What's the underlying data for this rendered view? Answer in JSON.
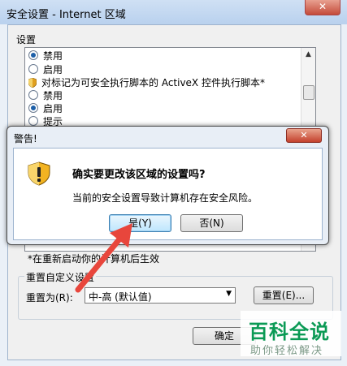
{
  "window": {
    "title": "安全设置 - Internet 区域",
    "settings_label": "设置",
    "items": [
      {
        "type": "radio",
        "label": "禁用",
        "checked": true
      },
      {
        "type": "radio",
        "label": "启用",
        "checked": false
      },
      {
        "type": "header",
        "label": "对标记为可安全执行脚本的 ActiveX 控件执行脚本*",
        "icon": "shield-icon"
      },
      {
        "type": "radio",
        "label": "禁用",
        "checked": false
      },
      {
        "type": "radio",
        "label": "启用",
        "checked": true
      },
      {
        "type": "radio",
        "label": "提示",
        "checked": false
      }
    ],
    "restart_note": "*在重新启动你的计算机后生效",
    "reset_group_title": "重置自定义设置",
    "reset_to_label": "重置为(R):",
    "reset_select_value": "中-高 (默认值)",
    "reset_button": "重置(E)...",
    "ok_button": "确定"
  },
  "dialog": {
    "title": "警告!",
    "heading": "确实要更改该区域的设置吗?",
    "message": "当前的安全设置导致计算机存在安全风险。",
    "yes_button": "是(Y)",
    "no_button": "否(N)",
    "icon": "warning-shield-icon"
  },
  "watermark": {
    "main": "百科全说",
    "sub": "助你轻松解决"
  },
  "colors": {
    "accent": "#1d5fa8",
    "arrow": "#e8463c",
    "watermark_green": "#0b9a55"
  }
}
